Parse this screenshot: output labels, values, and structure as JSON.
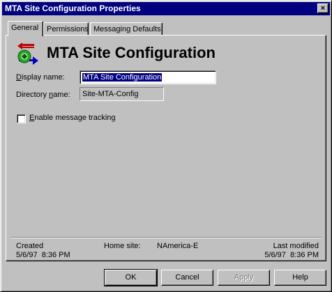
{
  "window": {
    "title": "MTA Site Configuration Properties",
    "close_glyph": "×"
  },
  "tabs": [
    {
      "label": "General",
      "active": true
    },
    {
      "label": "Permissions",
      "active": false
    },
    {
      "label": "Messaging Defaults",
      "active": false
    }
  ],
  "general": {
    "heading": "MTA Site Configuration",
    "display_name_label_pre": "D",
    "display_name_label_post": "isplay name:",
    "display_name_value": "MTA Site Configuration",
    "directory_name_label_pre": "Directory ",
    "directory_name_label_u": "n",
    "directory_name_label_post": "ame:",
    "directory_name_value": "Site-MTA-Config",
    "tracking_label_pre": "E",
    "tracking_label_post": "nable message tracking",
    "tracking_checked": false
  },
  "footer": {
    "created_label": "Created",
    "created_value": "5/6/97  8:36 PM",
    "home_site_label": "Home site:",
    "home_site_value": "NAmerica-E",
    "modified_label": "Last modified",
    "modified_value": "5/6/97  8:36 PM"
  },
  "buttons": {
    "ok": "OK",
    "cancel": "Cancel",
    "apply": "Apply",
    "help": "Help"
  },
  "colors": {
    "titlebar": "#000080",
    "face": "#c0c0c0",
    "selection": "#000080"
  }
}
